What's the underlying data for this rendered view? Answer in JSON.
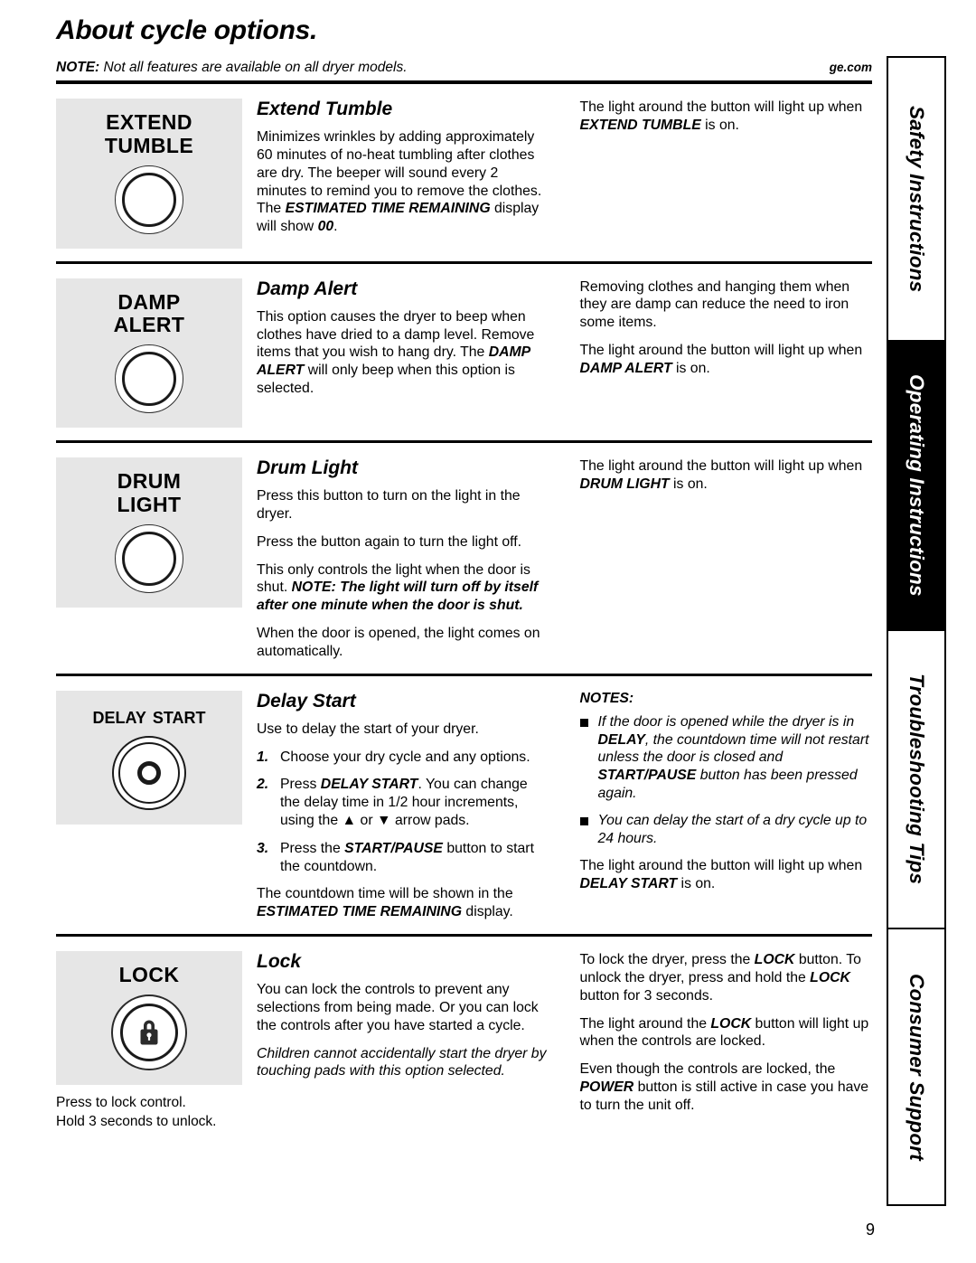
{
  "header": {
    "title": "About cycle options.",
    "note_label": "NOTE:",
    "note_text": " Not all features are available on all dryer models.",
    "site": "ge.com"
  },
  "sections": [
    {
      "id": "extend-tumble",
      "button_label": "EXTEND\nTUMBLE",
      "button_glyph": "ring-button",
      "heading": "Extend Tumble",
      "left_paragraphs": [
        "Minimizes wrinkles by adding approximately 60 minutes of no-heat tumbling after clothes are dry. The beeper will sound every 2 minutes to remind you to remove the clothes. The ESTIMATED TIME REMAINING display will show 00."
      ],
      "right_paragraphs": [
        "The light around the button will light up when EXTEND TUMBLE is on."
      ]
    },
    {
      "id": "damp-alert",
      "button_label": "DAMP\nALERT",
      "button_glyph": "ring-button",
      "heading": "Damp Alert",
      "left_paragraphs": [
        "This option causes the dryer to beep when clothes have dried to a damp level. Remove items that you wish to hang dry. The DAMP ALERT will only beep when this option is selected."
      ],
      "right_paragraphs": [
        "Removing clothes and hanging them when they are damp can reduce the need to iron some items.",
        "The light around the button will light up when DAMP ALERT is on."
      ]
    },
    {
      "id": "drum-light",
      "button_label": "DRUM\nLIGHT",
      "button_glyph": "ring-button",
      "heading": "Drum Light",
      "left_paragraphs": [
        "Press this button to turn on the light in the dryer.",
        "Press the button again to turn the light off.",
        "This only controls the light when the door is shut. NOTE: The light will turn off by itself after one minute when the door is shut.",
        "When the door is opened, the light comes on automatically."
      ],
      "right_paragraphs": [
        "The light around the button will light up when DRUM LIGHT is on."
      ]
    },
    {
      "id": "delay-start",
      "button_label": "Delay Start",
      "button_glyph": "power-ring-button",
      "heading": "Delay Start",
      "intro": "Use to delay the start of your dryer.",
      "steps": [
        {
          "num": "1.",
          "text": "Choose your dry cycle and any options."
        },
        {
          "num": "2.",
          "text": "Press DELAY START. You can change the delay time in 1/2 hour increments, using the ▲ or ▼ arrow pads."
        },
        {
          "num": "3.",
          "text": "Press the START/PAUSE button to start the countdown."
        }
      ],
      "closing": "The countdown time will be shown in the ESTIMATED TIME REMAINING display.",
      "notes_title": "NOTES:",
      "notes": [
        "If the door is opened while the dryer is in DELAY, the countdown time will not restart unless the door is closed and START/PAUSE button has been pressed again.",
        "You can delay the start of a dry cycle up to 24 hours."
      ],
      "right_paragraphs": [
        "The light around the button will light up when DELAY START is on."
      ]
    },
    {
      "id": "lock",
      "button_label": "LOCK",
      "button_glyph": "padlock-button",
      "caption": "Press to lock control.\nHold 3 seconds to unlock.",
      "heading": "Lock",
      "left_paragraphs": [
        "You can lock the controls to prevent any selections from being made. Or you can lock the controls after you have started a cycle.",
        "Children cannot accidentally start the dryer by touching pads with this option selected."
      ],
      "right_paragraphs": [
        "To lock the dryer, press the LOCK button. To unlock the dryer, press and hold the LOCK button for 3 seconds.",
        "The light around the LOCK button will light up when the controls are locked.",
        "Even though the controls are locked, the POWER button is still active in case you have to turn the unit off."
      ]
    }
  ],
  "tabs": [
    {
      "label": "Safety Instructions",
      "active": false
    },
    {
      "label": "Operating Instructions",
      "active": true
    },
    {
      "label": "Troubleshooting Tips",
      "active": false
    },
    {
      "label": "Consumer Support",
      "active": false
    }
  ],
  "page_number": "9",
  "colors": {
    "panel_gray": "#e6e6e6",
    "active_tab": "#000000",
    "text": "#000000"
  }
}
